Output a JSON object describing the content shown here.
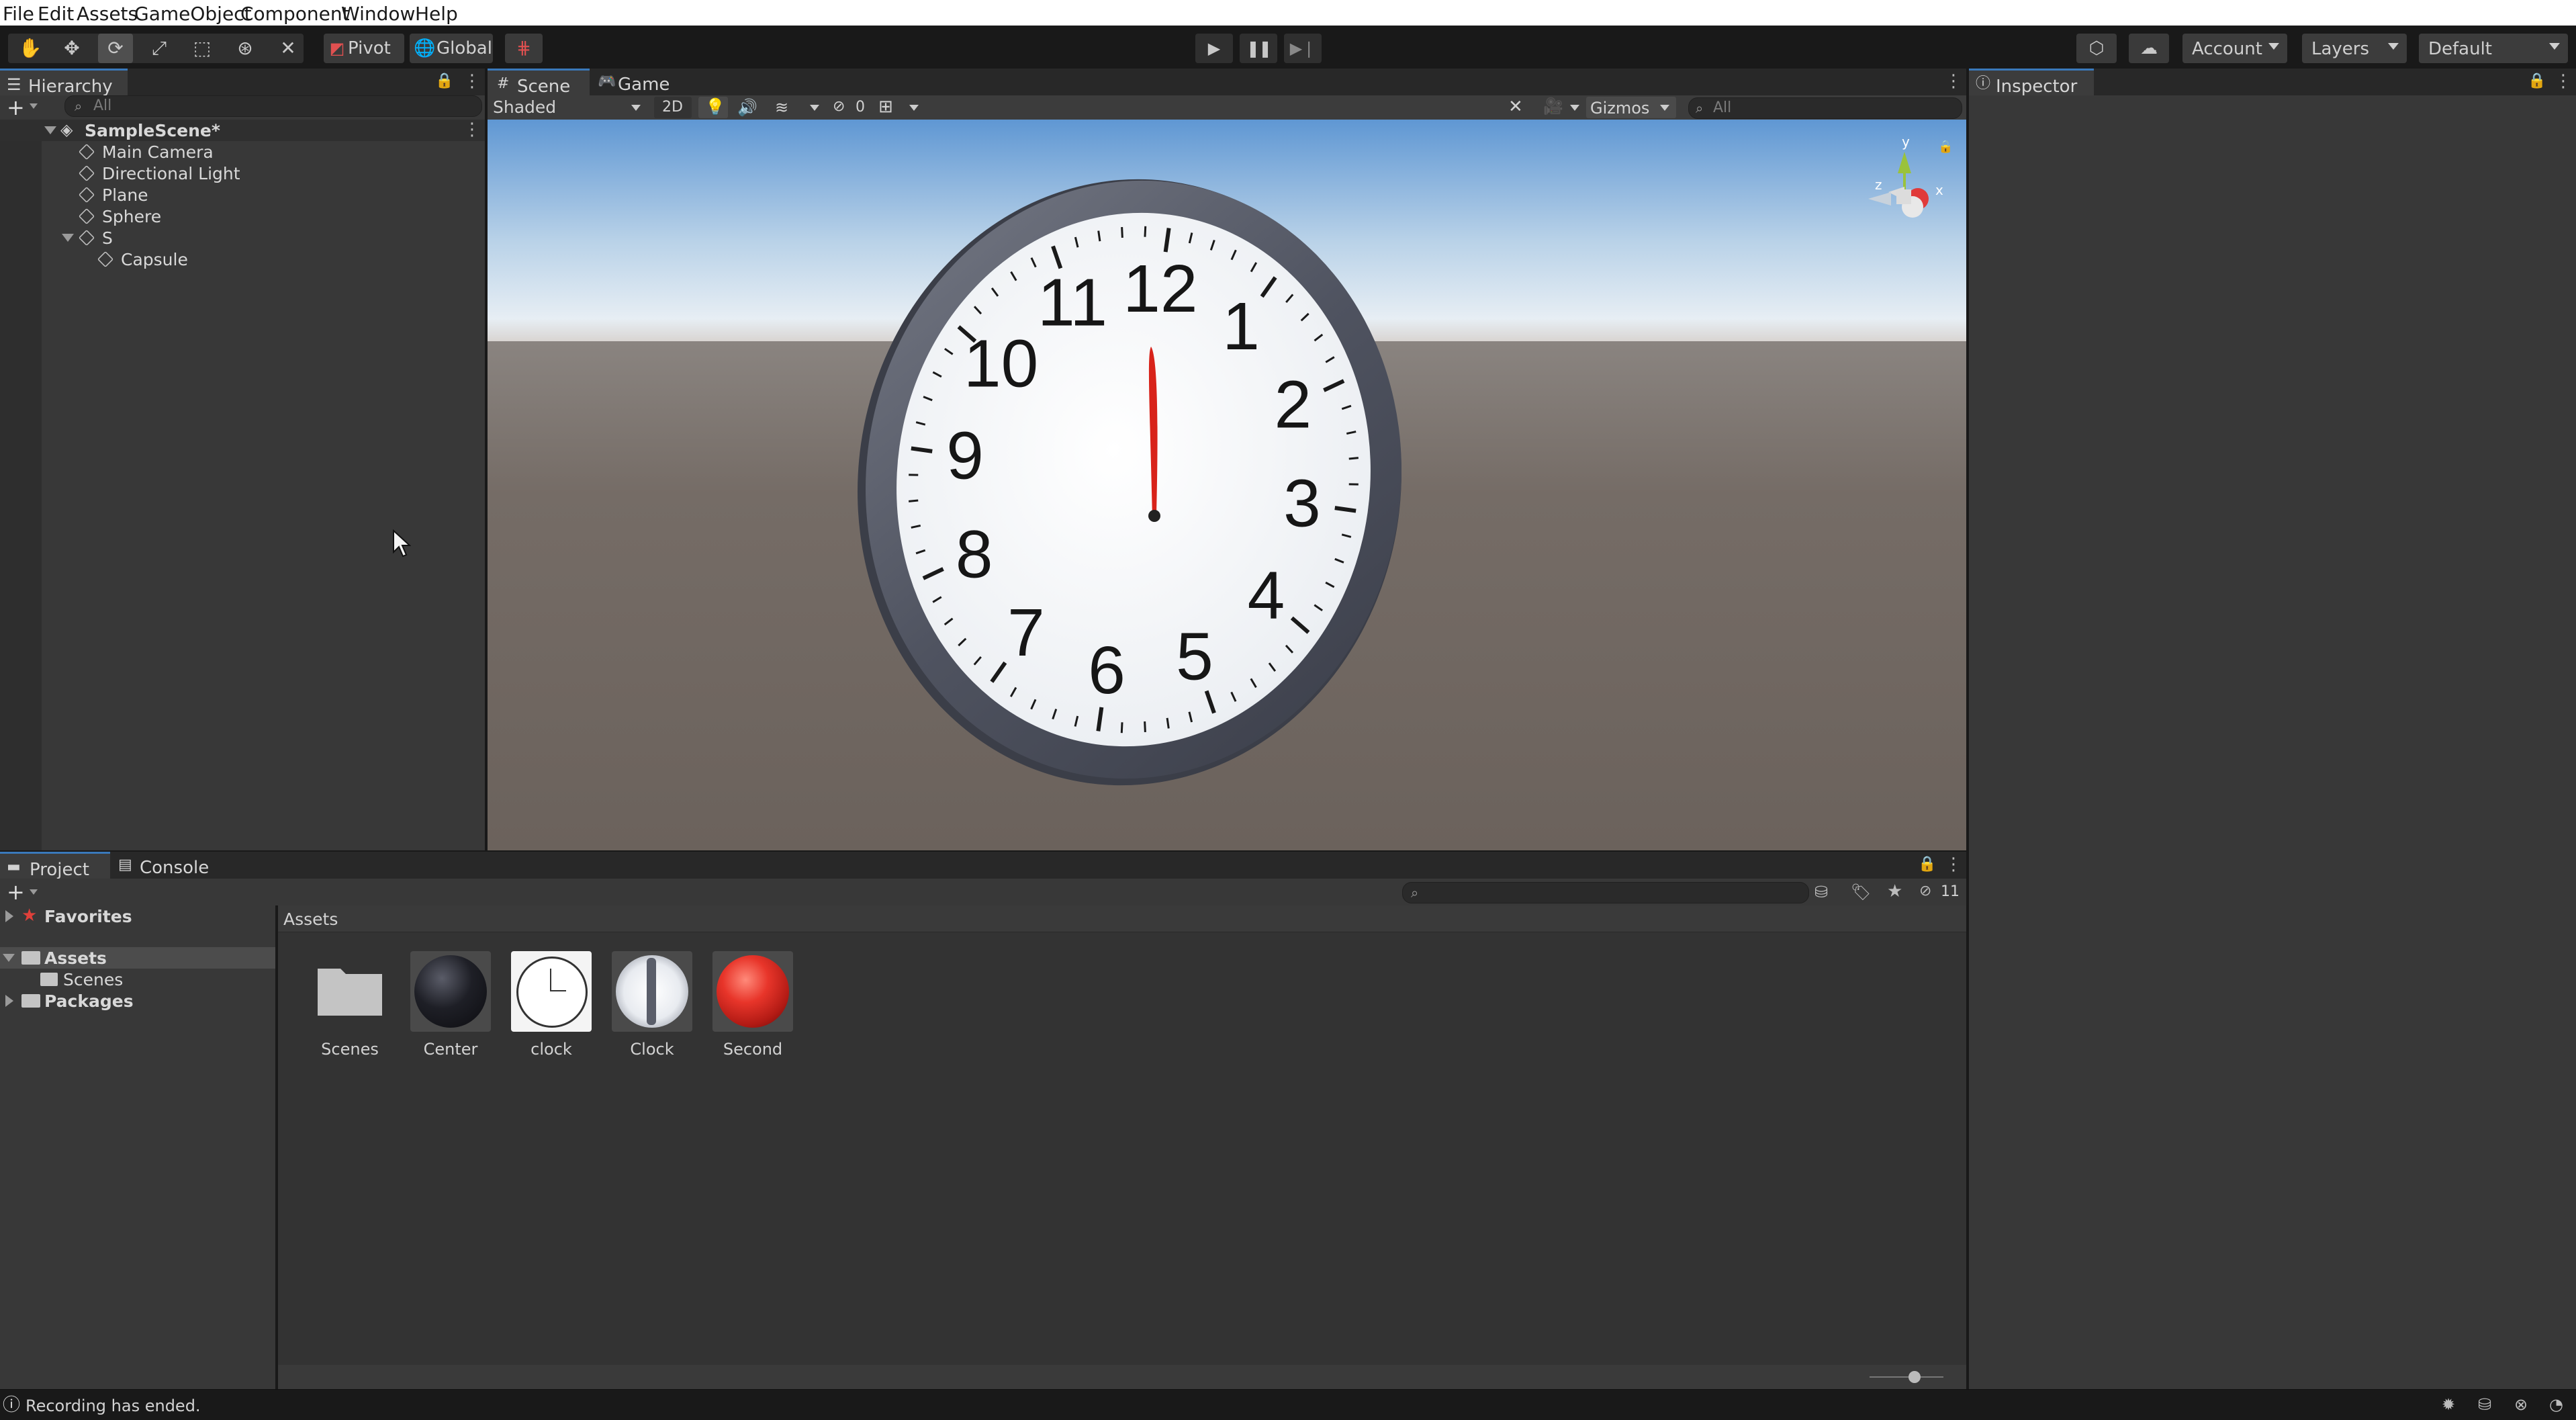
{
  "menu": [
    "File",
    "Edit",
    "Assets",
    "GameObject",
    "Component",
    "Window",
    "Help"
  ],
  "toolbar": {
    "pivot_label": "Pivot",
    "global_label": "Global",
    "account_label": "Account",
    "layers_label": "Layers",
    "layout_label": "Default"
  },
  "hierarchy": {
    "tab_label": "Hierarchy",
    "search_placeholder": "All",
    "scene_name": "SampleScene*",
    "items": [
      "Main Camera",
      "Directional Light",
      "Plane",
      "Sphere",
      "S",
      "Capsule"
    ]
  },
  "scene": {
    "tabs": [
      "Scene",
      "Game"
    ],
    "shading_mode": "Shaded",
    "mode_2d": "2D",
    "hidden_count": "0",
    "gizmos_label": "Gizmos",
    "search_placeholder": "All",
    "axis_labels": {
      "y": "y",
      "x": "x",
      "z": "z"
    },
    "clock_numbers": [
      "12",
      "1",
      "2",
      "3",
      "4",
      "5",
      "6",
      "7",
      "8",
      "9",
      "10",
      "11"
    ]
  },
  "inspector": {
    "tab_label": "Inspector"
  },
  "project": {
    "tabs": [
      "Project",
      "Console"
    ],
    "tree": {
      "favorites": "Favorites",
      "assets": "Assets",
      "scenes": "Scenes",
      "packages": "Packages"
    },
    "breadcrumb": "Assets",
    "hidden_count": "11",
    "assets": [
      {
        "name": "Scenes",
        "kind": "folder"
      },
      {
        "name": "Center",
        "kind": "material-dark"
      },
      {
        "name": "clock",
        "kind": "texture-clock"
      },
      {
        "name": "Clock",
        "kind": "material-clock"
      },
      {
        "name": "Second",
        "kind": "material-red"
      }
    ]
  },
  "status_bar": {
    "message": "Recording has ended."
  },
  "colors": {
    "accent": "#3a79bb",
    "second_hand": "#d8231a",
    "sky_top": "#5f97d3",
    "ground": "#6f6660"
  }
}
